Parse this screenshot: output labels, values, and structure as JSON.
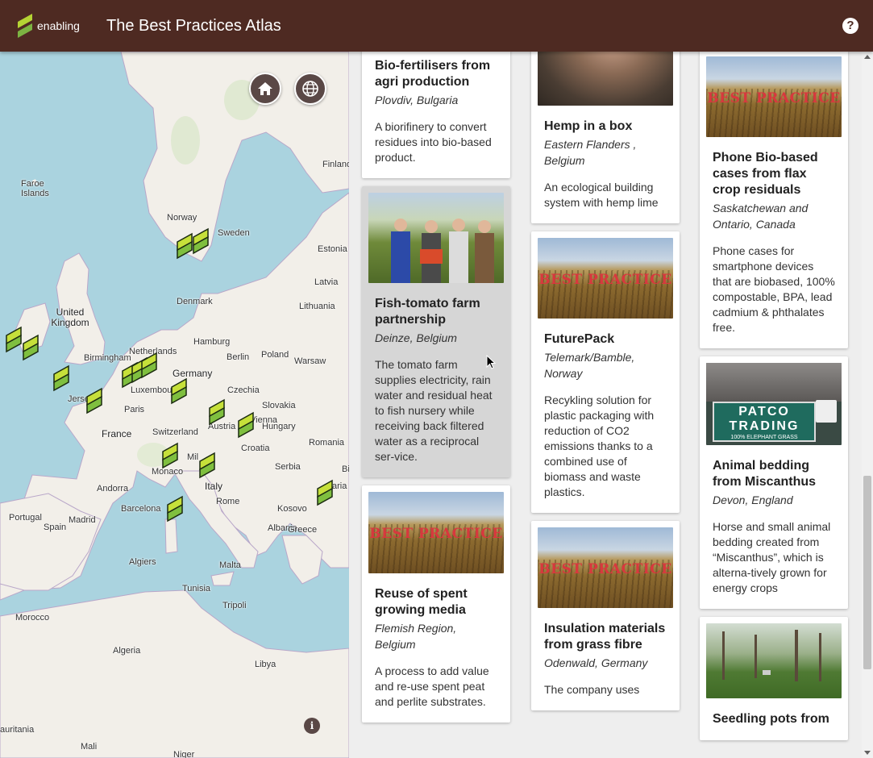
{
  "header": {
    "logo_text": "enabling",
    "title": "The Best Practices Atlas",
    "help_symbol": "?",
    "colors": {
      "bar": "#4e2a22",
      "logo_green": "#9acd32"
    }
  },
  "map": {
    "home_icon": "home-icon",
    "globe_icon": "globe-icon",
    "info_symbol": "i",
    "labels": [
      {
        "id": "faroe",
        "text": "Faroe Islands"
      },
      {
        "id": "norway",
        "text": "Norway"
      },
      {
        "id": "sweden",
        "text": "Sweden"
      },
      {
        "id": "finland",
        "text": "Finland"
      },
      {
        "id": "estonia",
        "text": "Estonia"
      },
      {
        "id": "latvia",
        "text": "Latvia"
      },
      {
        "id": "lithuania",
        "text": "Lithuania"
      },
      {
        "id": "denmark",
        "text": "Denmark"
      },
      {
        "id": "uk",
        "text": "United Kingdom"
      },
      {
        "id": "birmingham",
        "text": "Birmingham"
      },
      {
        "id": "netherlands",
        "text": "Netherlands"
      },
      {
        "id": "hamburg",
        "text": "Hamburg"
      },
      {
        "id": "berlin",
        "text": "Berlin"
      },
      {
        "id": "poland",
        "text": "Poland"
      },
      {
        "id": "warsaw",
        "text": "Warsaw"
      },
      {
        "id": "germany",
        "text": "Germany"
      },
      {
        "id": "luxembourg",
        "text": "Luxembourg"
      },
      {
        "id": "jersey",
        "text": "Jersey"
      },
      {
        "id": "paris",
        "text": "Paris"
      },
      {
        "id": "czechia",
        "text": "Czechia"
      },
      {
        "id": "slovakia",
        "text": "Slovakia"
      },
      {
        "id": "austria",
        "text": "Austria"
      },
      {
        "id": "vienna",
        "text": "Vienna"
      },
      {
        "id": "hungary",
        "text": "Hungary"
      },
      {
        "id": "france",
        "text": "France"
      },
      {
        "id": "switzerland",
        "text": "Switzerland"
      },
      {
        "id": "milan",
        "text": "Mil"
      },
      {
        "id": "croatia",
        "text": "Croatia"
      },
      {
        "id": "romania",
        "text": "Romania"
      },
      {
        "id": "monaco",
        "text": "Monaco"
      },
      {
        "id": "serbia",
        "text": "Serbia"
      },
      {
        "id": "italy",
        "text": "Italy"
      },
      {
        "id": "bulgaria_partial",
        "text": "Bi"
      },
      {
        "id": "andorra",
        "text": "Andorra"
      },
      {
        "id": "kosovo",
        "text": "Kosovo"
      },
      {
        "id": "bulgaria2",
        "text": "aria"
      },
      {
        "id": "barcelona",
        "text": "Barcelona"
      },
      {
        "id": "rome",
        "text": "Rome"
      },
      {
        "id": "portugal",
        "text": "Portugal"
      },
      {
        "id": "madrid",
        "text": "Madrid"
      },
      {
        "id": "spain",
        "text": "Spain"
      },
      {
        "id": "albania",
        "text": "Albania"
      },
      {
        "id": "greece",
        "text": "Greece"
      },
      {
        "id": "algiers",
        "text": "Algiers"
      },
      {
        "id": "malta",
        "text": "Malta"
      },
      {
        "id": "tunisia",
        "text": "Tunisia"
      },
      {
        "id": "tripoli",
        "text": "Tripoli"
      },
      {
        "id": "morocco",
        "text": "Morocco"
      },
      {
        "id": "algeria",
        "text": "Algeria"
      },
      {
        "id": "libya",
        "text": "Libya"
      },
      {
        "id": "mauritania",
        "text": "auritania"
      },
      {
        "id": "mali",
        "text": "Mali"
      },
      {
        "id": "niger",
        "text": "Niger"
      }
    ]
  },
  "cards": {
    "col1": [
      {
        "title": "Bio-fertilisers from agri production",
        "location": "Plovdiv, Bulgaria",
        "description": "A biorifinery to convert residues into bio-based product."
      },
      {
        "title": "Fish-tomato farm partnership",
        "location": "Deinze, Belgium",
        "description": "The tomato farm supplies electricity, rain water and residual heat to fish nursery while receiving back filtered water as a reciprocal ser-vice."
      },
      {
        "title": "Reuse of spent growing media",
        "location": "Flemish Region, Belgium",
        "description": "A process to add value and re-use spent peat and perlite substrates.",
        "image_caption": "BEST PRACTICE"
      }
    ],
    "col2": [
      {
        "title": "Hemp in a box",
        "location": "Eastern Flanders , Belgium",
        "description": "An ecological building system with hemp lime"
      },
      {
        "title": "FuturePack",
        "location": "Telemark/Bamble, Norway",
        "description": "Recykling solution for plastic packaging with reduction of CO2 emissions thanks to a combined use of biomass and waste plastics.",
        "image_caption": "BEST PRACTICE"
      },
      {
        "title": "Insulation materials from grass fibre",
        "location": "Odenwald, Germany",
        "description": "The company uses",
        "image_caption": "BEST PRACTICE"
      }
    ],
    "col3": [
      {
        "title": "Phone Bio-based cases from flax crop residuals",
        "location": "Saskatchewan and Ontario, Canada",
        "description": "Phone cases for smartphone devices that are biobased, 100% compostable, BPA, lead cadmium & phthalates free.",
        "image_caption": "BEST PRACTICE"
      },
      {
        "title": "Animal bedding from Miscanthus",
        "location": "Devon, England",
        "description": "Horse and small animal bedding created from “Miscanthus”, which is alterna-tively grown for energy crops",
        "image_caption_1": "PATCO",
        "image_caption_2": "TRADING",
        "image_caption_3": "100% ELEPHANT GRASS"
      },
      {
        "title": "Seedling pots from",
        "location": "",
        "description": ""
      }
    ]
  }
}
